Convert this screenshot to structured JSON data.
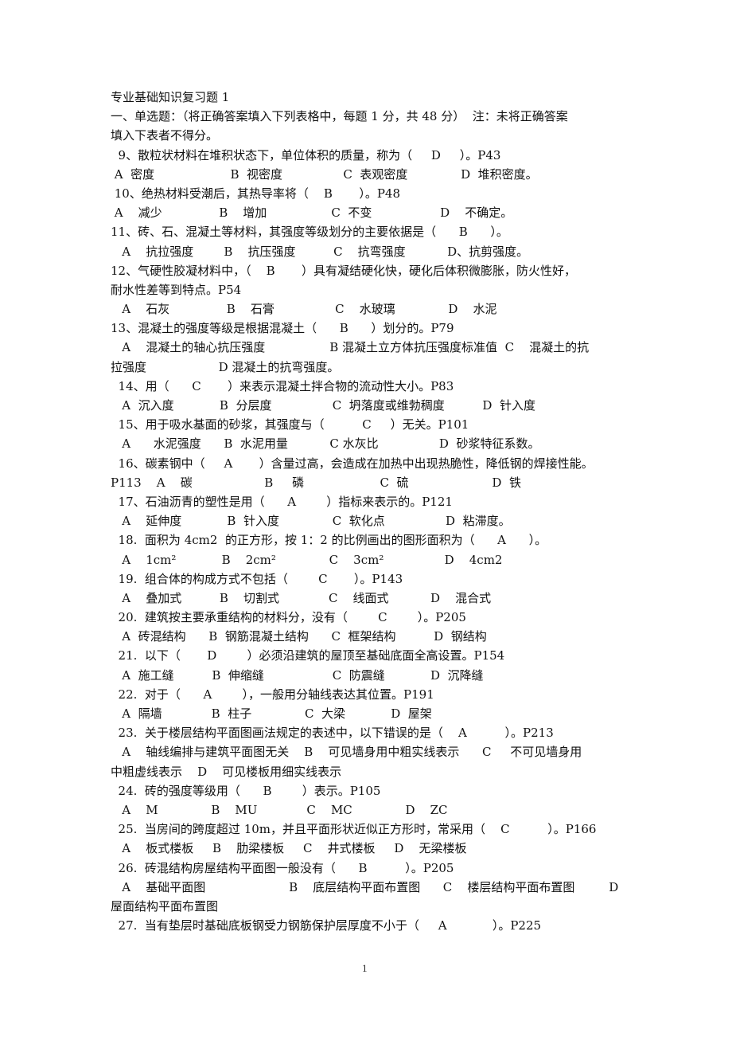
{
  "document": {
    "title": "专业基础知识复习题 1",
    "instructions": [
      "一、单选题：（将正确答案填入下列表格中，每题 1 分，共 48 分）  注：未将正确答案",
      "填入下表者不得分。"
    ],
    "lines": [
      {
        "text": "  9、散粒状材料在堆积状态下，单位体积的质量，称为（     D     ）。P43",
        "type": "question",
        "number": "9",
        "answer": "D",
        "page_ref": "P43"
      },
      {
        "text": " A  密度                    B  视密度                C  表观密度              D  堆积密度。",
        "type": "options"
      },
      {
        "text": " 10、绝热材料受潮后，其热导率将（    B       ）。P48",
        "type": "question",
        "number": "10",
        "answer": "B",
        "page_ref": "P48"
      },
      {
        "text": " A    减少               B    增加                 C  不变                  D    不确定。",
        "type": "options"
      },
      {
        "text": "11、砖、石、混凝土等材料，其强度等级划分的主要依据是（      B      ）。",
        "type": "question",
        "number": "11",
        "answer": "B"
      },
      {
        "text": "   A    抗拉强度        B    抗压强度          C    抗弯强度           D、抗剪强度。",
        "type": "options"
      },
      {
        "text": "12、气硬性胶凝材料中，（    B       ）具有凝结硬化快，硬化后体积微膨胀，防火性好，",
        "type": "question",
        "number": "12",
        "answer": "B"
      },
      {
        "text": "耐水性差等到特点。P54",
        "type": "continuation",
        "page_ref": "P54"
      },
      {
        "text": "   A    石灰               B    石膏                C    水玻璃              D    水泥",
        "type": "options"
      },
      {
        "text": "13、混凝土的强度等级是根据混凝土（      B      ）划分的。P79",
        "type": "question",
        "number": "13",
        "answer": "B",
        "page_ref": "P79"
      },
      {
        "text": "   A    混凝土的轴心抗压强度                 B 混凝土立方体抗压强度标准值  C    混凝土的抗",
        "type": "options"
      },
      {
        "text": "拉强度                   D 混凝土的抗弯强度。",
        "type": "continuation"
      },
      {
        "text": "  14、用（      C       ）来表示混凝土拌合物的流动性大小。P83",
        "type": "question",
        "number": "14",
        "answer": "C",
        "page_ref": "P83"
      },
      {
        "text": "   A  沉入度            B  分层度                C  坍落度或维勃稠度          D  针入度",
        "type": "options"
      },
      {
        "text": "  15、用于吸水基面的砂浆，其强度与（          C     ）无关。P101",
        "type": "question",
        "number": "15",
        "answer": "C",
        "page_ref": "P101"
      },
      {
        "text": "   A      水泥强度      B  水泥用量           C 水灰比                D  砂浆特征系数。",
        "type": "options"
      },
      {
        "text": "  16、碳素钢中（     A       ）含量过高，会造成在加热中出现热脆性，降低钢的焊接性能。",
        "type": "question",
        "number": "16",
        "answer": "A"
      },
      {
        "text": "P113    A    碳                   B     磷                    C  硫                      D  铁",
        "type": "options",
        "page_ref": "P113"
      },
      {
        "text": "  17、石油沥青的塑性是用（      A        ）指标来表示的。P121",
        "type": "question",
        "number": "17",
        "answer": "A",
        "page_ref": "P121"
      },
      {
        "text": "   A    延伸度            B  针入度              C  软化点                D  粘滞度。",
        "type": "options"
      },
      {
        "text": "  18.  面积为 4cm2  的正方形，按 1：2 的比例画出的图形面积为（      A      ）。",
        "type": "question",
        "number": "18",
        "answer": "A"
      },
      {
        "text": "   A    1cm²            B    2cm²              C    3cm²                D    4cm2",
        "type": "options"
      },
      {
        "text": "  19.  组合体的构成方式不包括（        C       ）。P143",
        "type": "question",
        "number": "19",
        "answer": "C",
        "page_ref": "P143"
      },
      {
        "text": "   A    叠加式          B    切割式             C    线面式           D    混合式",
        "type": "options"
      },
      {
        "text": "  20.  建筑按主要承重结构的材料分，没有（        C        ）。P205",
        "type": "question",
        "number": "20",
        "answer": "C",
        "page_ref": "P205"
      },
      {
        "text": "   A  砖混结构      B  钢筋混凝土结构      C  框架结构          D  钢结构",
        "type": "options"
      },
      {
        "text": "  21.  以下（       D        ）必须沿建筑的屋顶至基础底面全高设置。P154",
        "type": "question",
        "number": "21",
        "answer": "D",
        "page_ref": "P154"
      },
      {
        "text": "   A  施工缝          B  伸缩缝                  C  防震缝            D  沉降缝",
        "type": "options"
      },
      {
        "text": "  22.  对于（      A        ），一般用分轴线表达其位置。P191",
        "type": "question",
        "number": "22",
        "answer": "A",
        "page_ref": "P191"
      },
      {
        "text": "   A  隔墙             B  柱子              C  大梁            D  屋架",
        "type": "options"
      },
      {
        "text": "  23.  关于楼层结构平面图画法规定的表述中，以下错误的是（    A          ）。P213",
        "type": "question",
        "number": "23",
        "answer": "A",
        "page_ref": "P213"
      },
      {
        "text": "   A    轴线编排与建筑平面图无关    B    可见墙身用中粗实线表示      C     不可见墙身用",
        "type": "options"
      },
      {
        "text": "中粗虚线表示    D    可见楼板用细实线表示",
        "type": "continuation"
      },
      {
        "text": "  24.  砖的强度等级用（      B        ）表示。P105",
        "type": "question",
        "number": "24",
        "answer": "B",
        "page_ref": "P105"
      },
      {
        "text": "   A    M              B    MU             C    MC              D    ZC",
        "type": "options"
      },
      {
        "text": "  25.  当房间的跨度超过 10m，并且平面形状近似正方形时，常采用（    C          ）。P166",
        "type": "question",
        "number": "25",
        "answer": "C",
        "page_ref": "P166"
      },
      {
        "text": "   A    板式楼板     B    肋梁楼板     C    井式楼板     D    无梁楼板",
        "type": "options"
      },
      {
        "text": "  26.  砖混结构房屋结构平面图一般没有（      B          ）。P205",
        "type": "question",
        "number": "26",
        "answer": "B",
        "page_ref": "P205"
      },
      {
        "text": "   A    基础平面图                      B    底层结构平面布置图      C    楼层结构平面布置图         D",
        "type": "options"
      },
      {
        "text": "屋面结构平面布置图",
        "type": "continuation"
      },
      {
        "text": "  27.  当有垫层时基础底板钢受力钢筋保护层厚度不小于（     A            ）。P225",
        "type": "question",
        "number": "27",
        "answer": "A",
        "page_ref": "P225"
      }
    ]
  },
  "page_number": "1"
}
